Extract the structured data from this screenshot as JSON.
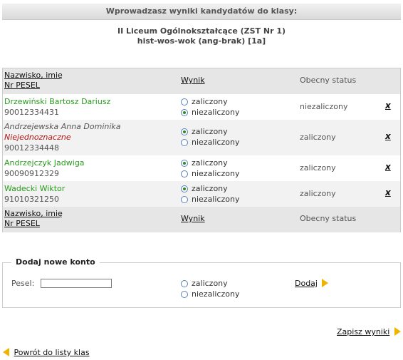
{
  "header": {
    "title": "Wprowadzasz wyniki kandydatów do klasy:"
  },
  "school": {
    "name": "II Liceum Ogólnokształcące (ZST Nr 1)",
    "class_name": "hist-wos-wok (ang-brak) [1a]"
  },
  "table": {
    "col_name": "Nazwisko, imię",
    "col_pesel": "Nr PESEL",
    "col_result": "Wynik",
    "col_status": "Obecny status",
    "option_pass": "zaliczony",
    "option_fail": "niezaliczony",
    "delete_label": "x",
    "rows": [
      {
        "name": "Drzewiński Bartosz Dariusz",
        "note": "",
        "pesel": "90012334431",
        "status": "niezaliczony",
        "selected": "fail",
        "name_color": "#2a9a1e"
      },
      {
        "name": "Andrzejewska Anna Dominika",
        "note": "Niejednoznaczne",
        "pesel": "90012334448",
        "status": "zaliczony",
        "selected": "pass",
        "name_color": "#555555"
      },
      {
        "name": "Andrzejczyk Jadwiga",
        "note": "",
        "pesel": "90090912329",
        "status": "zaliczony",
        "selected": "pass",
        "name_color": "#2a9a1e"
      },
      {
        "name": "Wadecki Wiktor",
        "note": "",
        "pesel": "91010321250",
        "status": "zaliczony",
        "selected": "pass",
        "name_color": "#2a9a1e"
      }
    ]
  },
  "new_account": {
    "legend": "Dodaj nowe konto",
    "pesel_label": "Pesel:",
    "pesel_value": "",
    "option_pass": "zaliczony",
    "option_fail": "niezaliczony",
    "add_label": "Dodaj"
  },
  "actions": {
    "save_label": "Zapisz wyniki",
    "back_label": "Powrót do listy klas"
  },
  "colors": {
    "accent_arrow": "#f0b400",
    "pass_name": "#2a9a1e",
    "ambiguous": "#b01717"
  }
}
